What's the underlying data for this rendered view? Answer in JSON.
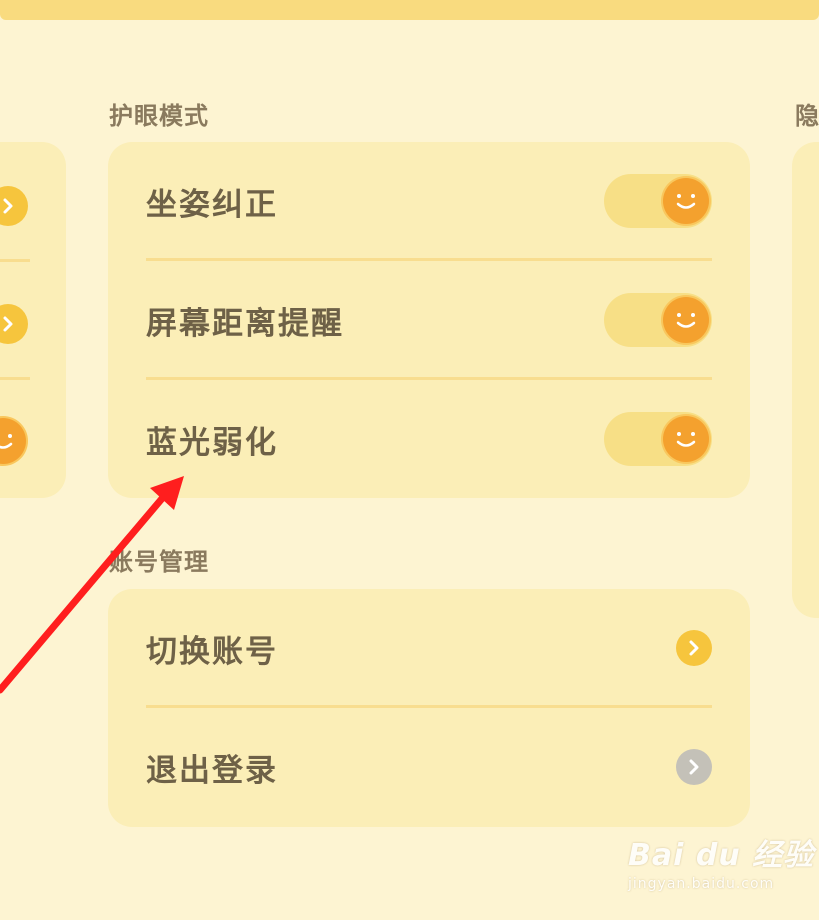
{
  "sections": {
    "eye_care": {
      "title": "护眼模式",
      "items": [
        {
          "label": "坐姿纠正",
          "toggle_on": true
        },
        {
          "label": "屏幕距离提醒",
          "toggle_on": true
        },
        {
          "label": "蓝光弱化",
          "toggle_on": true
        }
      ]
    },
    "account": {
      "title": "账号管理",
      "items": [
        {
          "label": "切换账号",
          "chevron_state": "active"
        },
        {
          "label": "退出登录",
          "chevron_state": "disabled"
        }
      ]
    },
    "right_partial_title": "隐"
  },
  "icons": {
    "toggle_knob": "smiley-face-icon",
    "chevron": "chevron-right-icon"
  },
  "watermark": {
    "logo_text": "Bai du 经验",
    "url": "jingyan.baidu.com"
  },
  "colors": {
    "background": "#fdf4d2",
    "card": "#fbeeb7",
    "accent": "#f4a12e",
    "chevron_active": "#f6c53d",
    "chevron_disabled": "#c4c1b8",
    "annotation_arrow": "#ff1e1e"
  }
}
